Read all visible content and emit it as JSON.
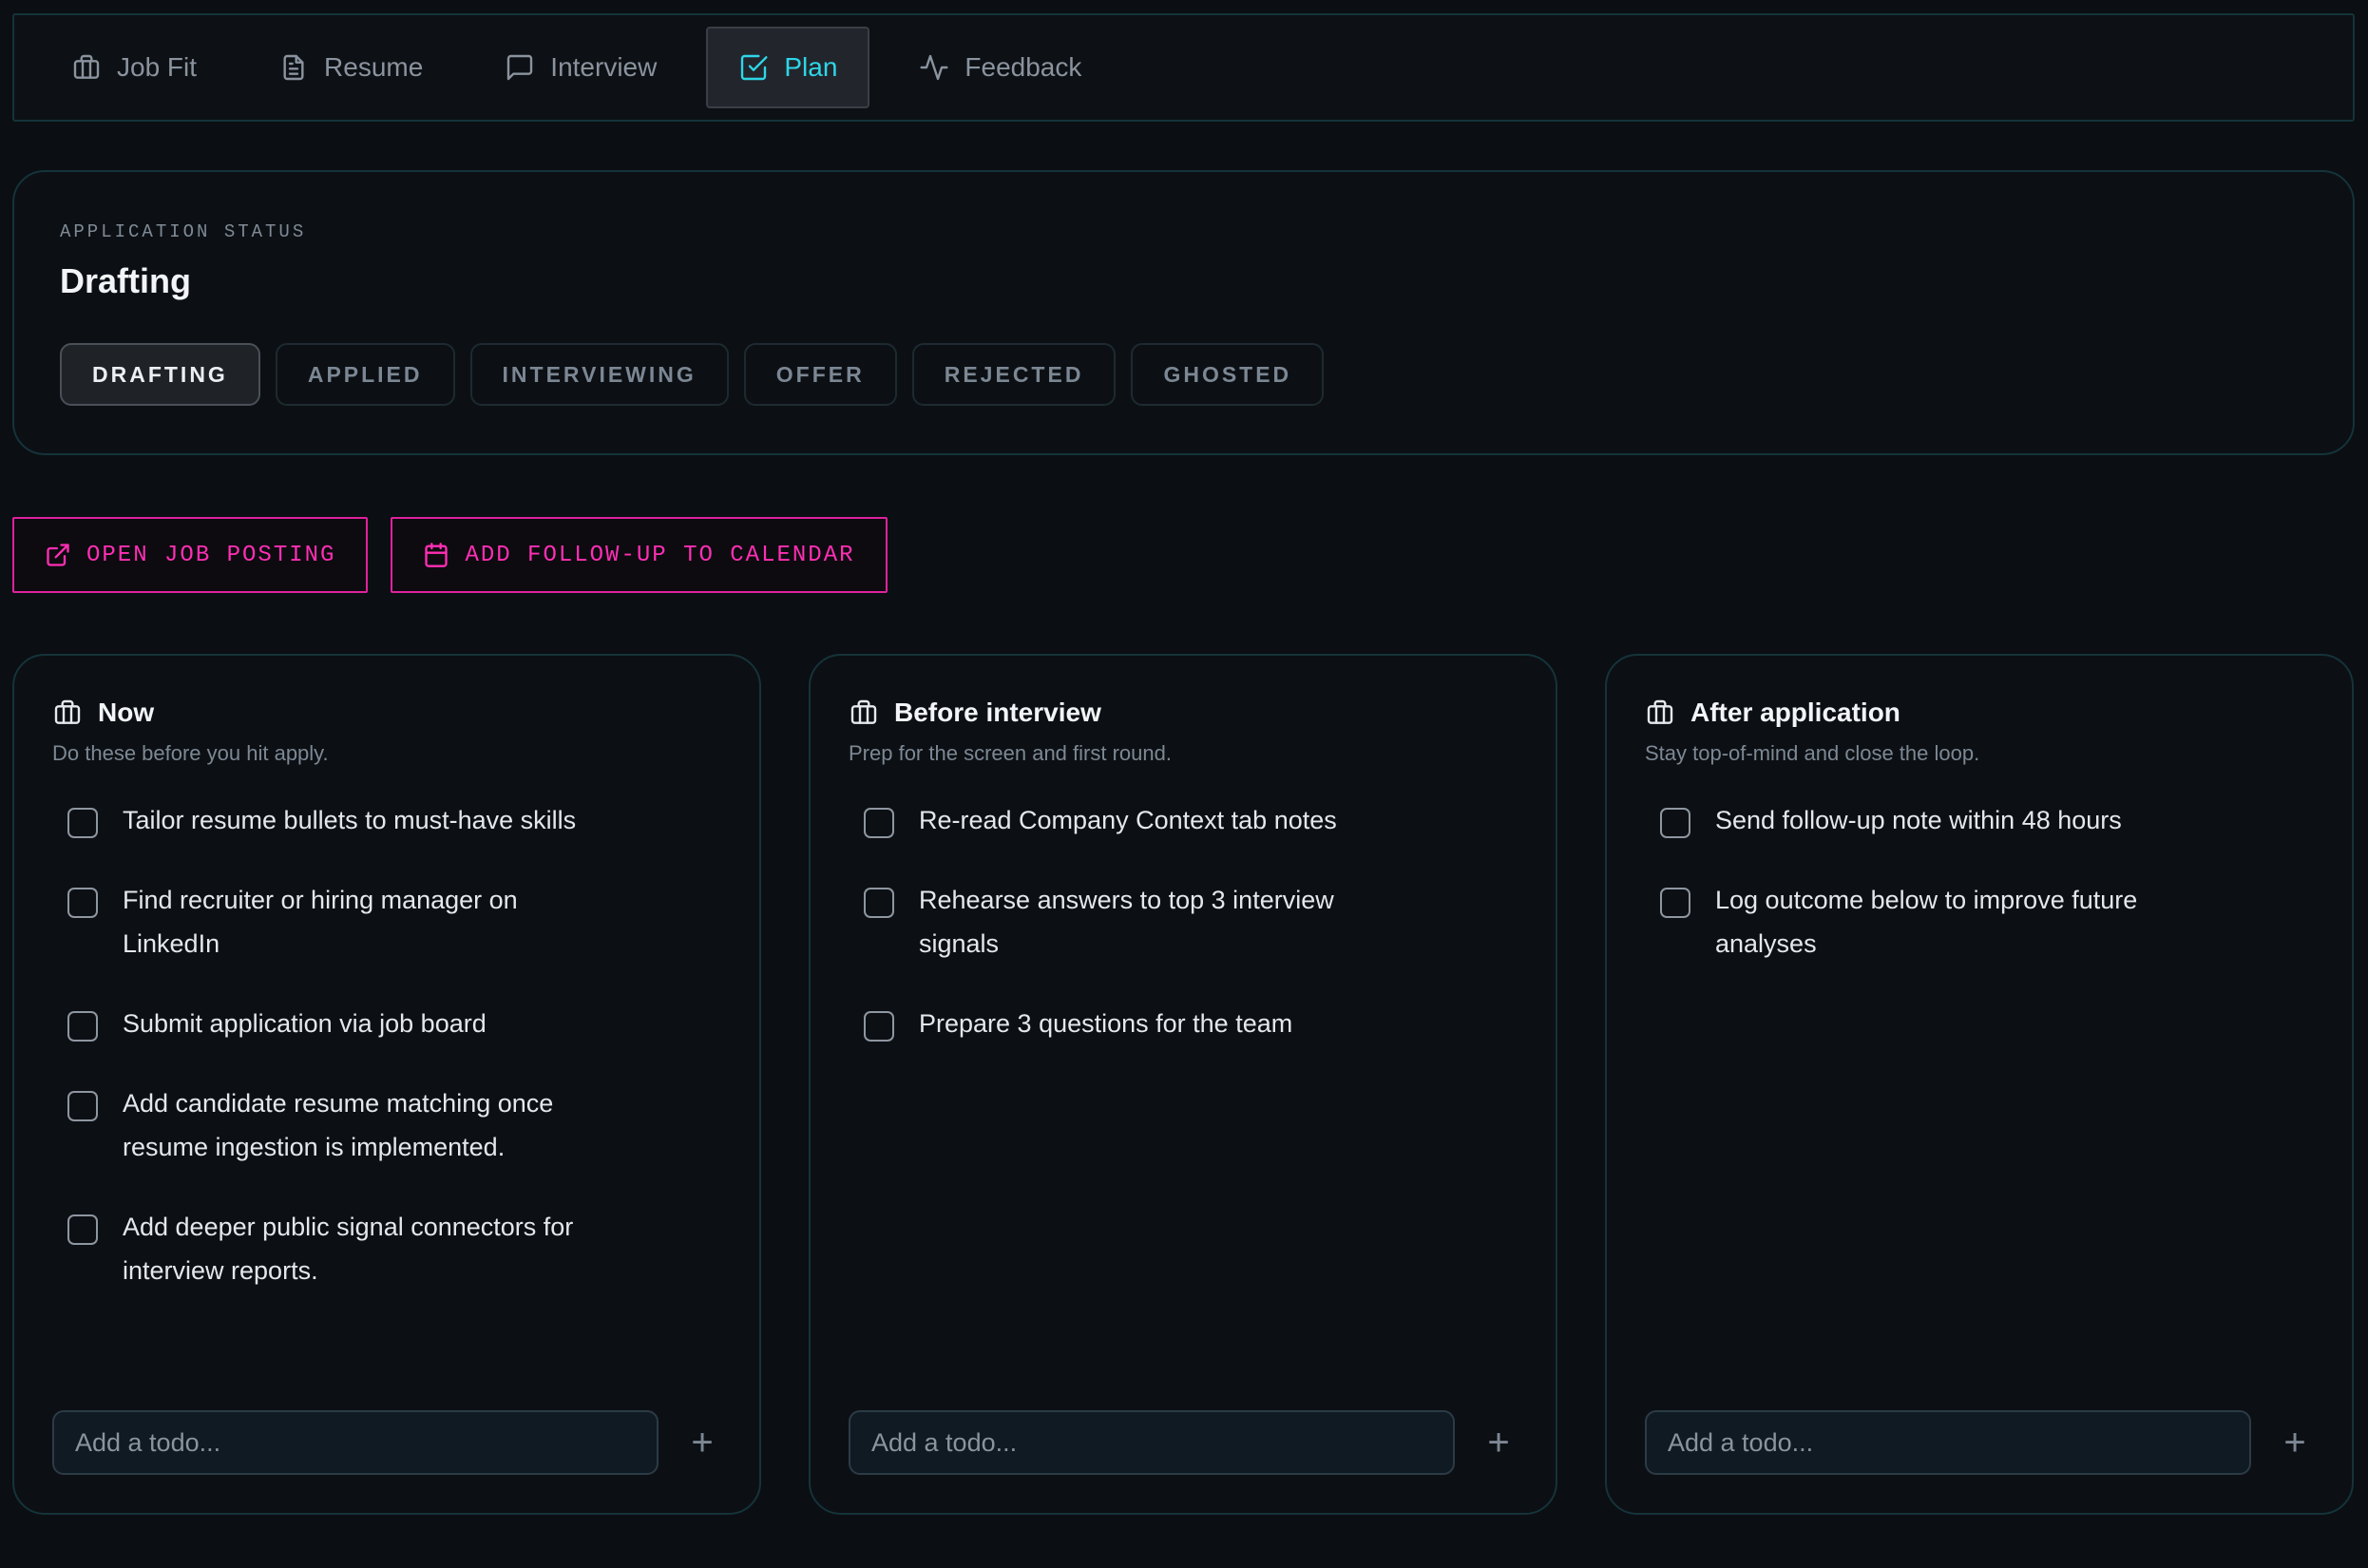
{
  "tabs": [
    {
      "label": "Job Fit",
      "icon": "briefcase-icon",
      "active": false
    },
    {
      "label": "Resume",
      "icon": "file-text-icon",
      "active": false
    },
    {
      "label": "Interview",
      "icon": "message-square-icon",
      "active": false
    },
    {
      "label": "Plan",
      "icon": "check-square-icon",
      "active": true
    },
    {
      "label": "Feedback",
      "icon": "activity-icon",
      "active": false
    }
  ],
  "status": {
    "eyebrow": "APPLICATION STATUS",
    "title": "Drafting",
    "options": [
      "DRAFTING",
      "APPLIED",
      "INTERVIEWING",
      "OFFER",
      "REJECTED",
      "GHOSTED"
    ],
    "selected": "DRAFTING"
  },
  "actions": {
    "open_job_posting": "OPEN JOB POSTING",
    "add_follow_up": "ADD FOLLOW-UP TO CALENDAR"
  },
  "columns": [
    {
      "title": "Now",
      "subtitle": "Do these before you hit apply.",
      "todos": [
        "Tailor resume bullets to must-have skills",
        "Find recruiter or hiring manager on LinkedIn",
        "Submit application via job board",
        "Add candidate resume matching once resume ingestion is implemented.",
        "Add deeper public signal connectors for interview reports."
      ],
      "input_placeholder": "Add a todo...",
      "add_label": "+"
    },
    {
      "title": "Before interview",
      "subtitle": "Prep for the screen and first round.",
      "todos": [
        "Re-read Company Context tab notes",
        "Rehearse answers to top 3 interview signals",
        "Prepare 3 questions for the team"
      ],
      "input_placeholder": "Add a todo...",
      "add_label": "+"
    },
    {
      "title": "After application",
      "subtitle": "Stay top-of-mind and close the loop.",
      "todos": [
        "Send follow-up note within 48 hours",
        "Log outcome below to improve future analyses"
      ],
      "input_placeholder": "Add a todo...",
      "add_label": "+"
    }
  ],
  "colors": {
    "accent_cyan": "#2ed6e8",
    "accent_magenta": "#ff2fb4",
    "border": "#15333a",
    "background": "#0b0e12"
  }
}
